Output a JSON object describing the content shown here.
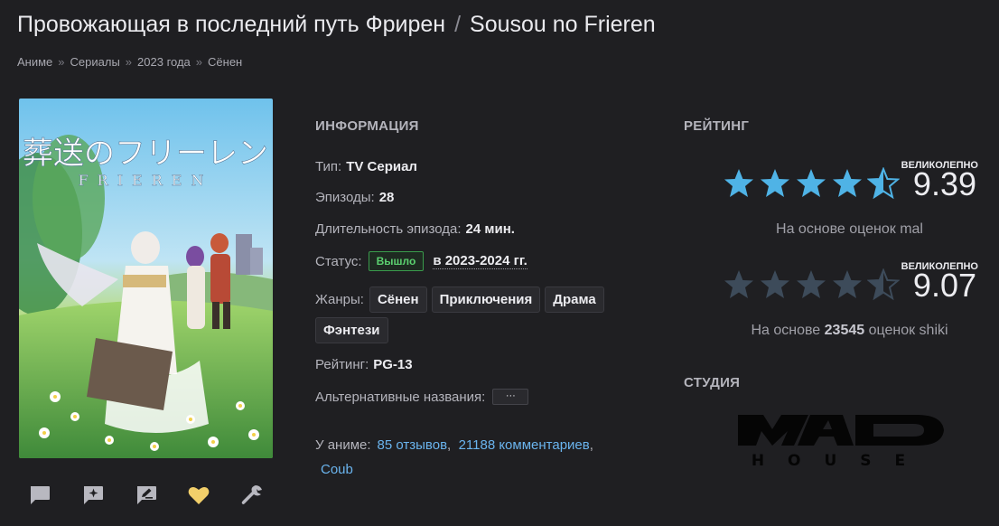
{
  "header": {
    "title_ru": "Провожающая в последний путь Фрирен",
    "separator": "/",
    "title_jp": "Sousou no Frieren"
  },
  "breadcrumbs": [
    "Аниме",
    "Сериалы",
    "2023 года",
    "Сёнен"
  ],
  "breadcrumb_sep": "»",
  "poster": {
    "logo_jp": "葬送のフリーレン",
    "logo_en": "FRIEREN"
  },
  "info": {
    "heading": "ИНФОРМАЦИЯ",
    "type_label": "Тип:",
    "type_value": "TV Сериал",
    "episodes_label": "Эпизоды:",
    "episodes_value": "28",
    "duration_label": "Длительность эпизода:",
    "duration_value": "24 мин.",
    "status_label": "Статус:",
    "status_badge": "Вышло",
    "status_years": "в 2023-2024 гг.",
    "genres_label": "Жанры:",
    "genres": [
      "Сёнен",
      "Приключения",
      "Драма",
      "Фэнтези"
    ],
    "rating_label": "Рейтинг:",
    "rating_value": "PG-13",
    "alt_names_label": "Альтернативные названия:",
    "alt_names_button": "···",
    "anime_label": "У аниме:",
    "reviews_link": "85 отзывов",
    "comments_link": "21188 комментариев",
    "coub_link": "Coub"
  },
  "rating": {
    "heading": "РЕЙТИНГ",
    "mal": {
      "label": "ВЕЛИКОЛЕПНО",
      "score": "9.39",
      "stars": 4.5,
      "note": "На основе оценок mal"
    },
    "shiki": {
      "label": "ВЕЛИКОЛЕПНО",
      "score": "9.07",
      "stars": 4.5,
      "note_prefix": "На основе",
      "note_count": "23545",
      "note_suffix": "оценок shiki"
    }
  },
  "studio": {
    "heading": "СТУДИЯ",
    "logo_text": "MAD HOUSE"
  },
  "actions": [
    "comment-icon",
    "add-review-icon",
    "edit-icon",
    "heart-icon",
    "wrench-icon"
  ],
  "colors": {
    "background": "#1f1f22",
    "link": "#6ab4ee",
    "star_active": "#4fb3e6",
    "star_inactive": "#3d4b5a",
    "status_green": "#5bd06f",
    "heart": "#f2cf6a"
  }
}
